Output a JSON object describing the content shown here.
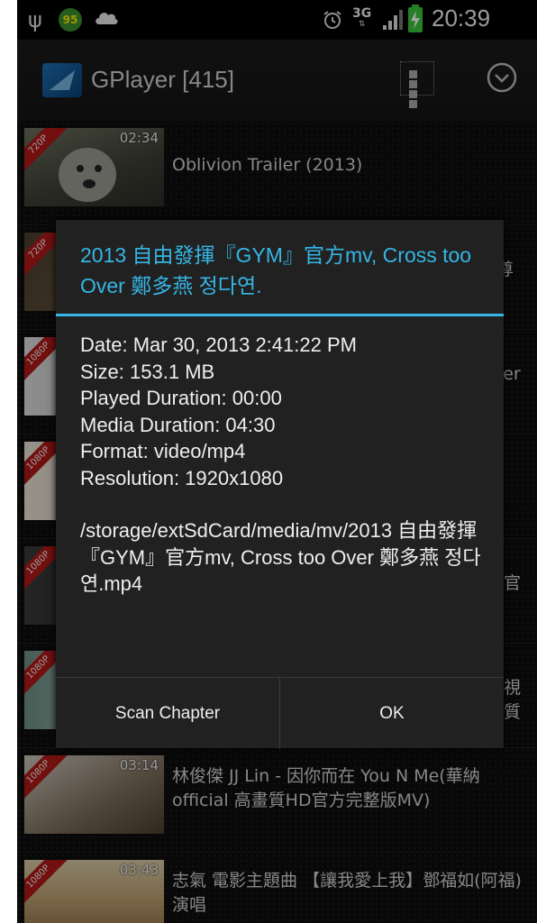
{
  "status_bar": {
    "notification_badge": "95",
    "network": "3G",
    "time": "20:39",
    "icons": [
      "usb-icon",
      "cloud-icon",
      "alarm-icon",
      "signal-icon",
      "battery-charging-icon"
    ]
  },
  "action_bar": {
    "title": "GPlayer [415]",
    "icons": [
      "app-logo-icon",
      "grid-view-icon",
      "overflow-menu-icon"
    ]
  },
  "list": {
    "items": [
      {
        "badge": "720P",
        "duration": "02:34",
        "title": "Oblivion Trailer (2013)"
      },
      {
        "badge": "720P",
        "duration": "",
        "title": "尊"
      },
      {
        "badge": "1080P",
        "duration": "",
        "title": "ver"
      },
      {
        "badge": "1080P",
        "duration": "",
        "title": ""
      },
      {
        "badge": "1080P",
        "duration": "",
        "title": "官"
      },
      {
        "badge": "1080P",
        "duration": "",
        "title": "視\n質"
      },
      {
        "badge": "1080P",
        "duration": "03:14",
        "title": "林俊傑 JJ Lin - 因你而在 You N Me(華納official 高畫質HD官方完整版MV)"
      },
      {
        "badge": "1080P",
        "duration": "03:43",
        "title": "志氣 電影主題曲 【讓我愛上我】鄧福如(阿福)演唱"
      }
    ]
  },
  "dialog": {
    "title": "2013 自由發揮『GYM』官方mv, Cross too Over 鄭多燕 정다연.",
    "info": {
      "date": "Date: Mar 30, 2013 2:41:22 PM",
      "size": "Size: 153.1 MB",
      "played": "Played Duration: 00:00",
      "media_duration": "Media Duration: 04:30",
      "format": "Format: video/mp4",
      "resolution": "Resolution: 1920x1080"
    },
    "path": "/storage/extSdCard/media/mv/2013 自由發揮『GYM』官方mv, Cross too Over 鄭多燕 정다연.mp4",
    "buttons": {
      "scan": "Scan Chapter",
      "ok": "OK"
    }
  },
  "colors": {
    "accent": "#35b6e6",
    "dialog_bg": "#212121",
    "ribbon": "#b01717"
  }
}
